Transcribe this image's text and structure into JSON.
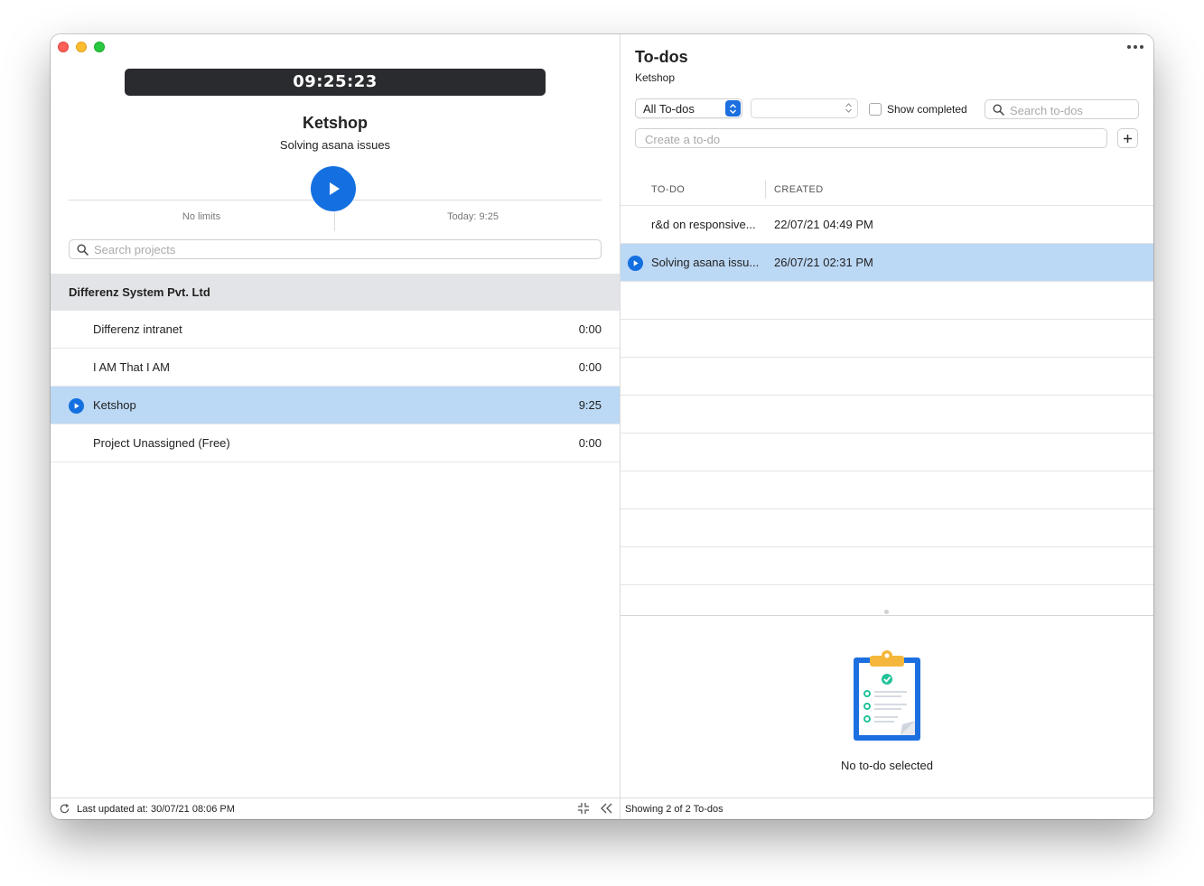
{
  "timer": {
    "display": "09:25:23"
  },
  "current": {
    "project": "Ketshop",
    "task": "Solving asana issues"
  },
  "limits": {
    "left": "No limits",
    "right": "Today: 9:25"
  },
  "project_search": {
    "placeholder": "Search projects"
  },
  "group": {
    "name": "Differenz System Pvt. Ltd"
  },
  "projects": [
    {
      "name": "Differenz intranet",
      "time": "0:00"
    },
    {
      "name": "I AM That I AM",
      "time": "0:00"
    },
    {
      "name": "Ketshop",
      "time": "9:25",
      "selected": true
    },
    {
      "name": "Project Unassigned (Free)",
      "time": "0:00"
    }
  ],
  "left_footer": {
    "last_updated": "Last updated at: 30/07/21 08:06 PM"
  },
  "todos": {
    "title": "To-dos",
    "subtitle": "Ketshop",
    "filter_selected": "All To-dos",
    "show_completed_label": "Show completed",
    "search_placeholder": "Search to-dos",
    "create_placeholder": "Create a to-do",
    "columns": {
      "todo": "TO-DO",
      "created": "CREATED"
    },
    "rows": [
      {
        "todo": "r&d on responsive...",
        "created": "22/07/21 04:49 PM"
      },
      {
        "todo": "Solving asana issu...",
        "created": "26/07/21 02:31 PM",
        "selected": true
      }
    ],
    "empty_detail": "No to-do selected",
    "footer": "Showing 2 of 2 To-dos"
  },
  "colors": {
    "accent": "#1470e0",
    "selection": "#bbd8f5",
    "timer_bg": "#2a2b2e",
    "group_bg": "#e3e4e7"
  }
}
